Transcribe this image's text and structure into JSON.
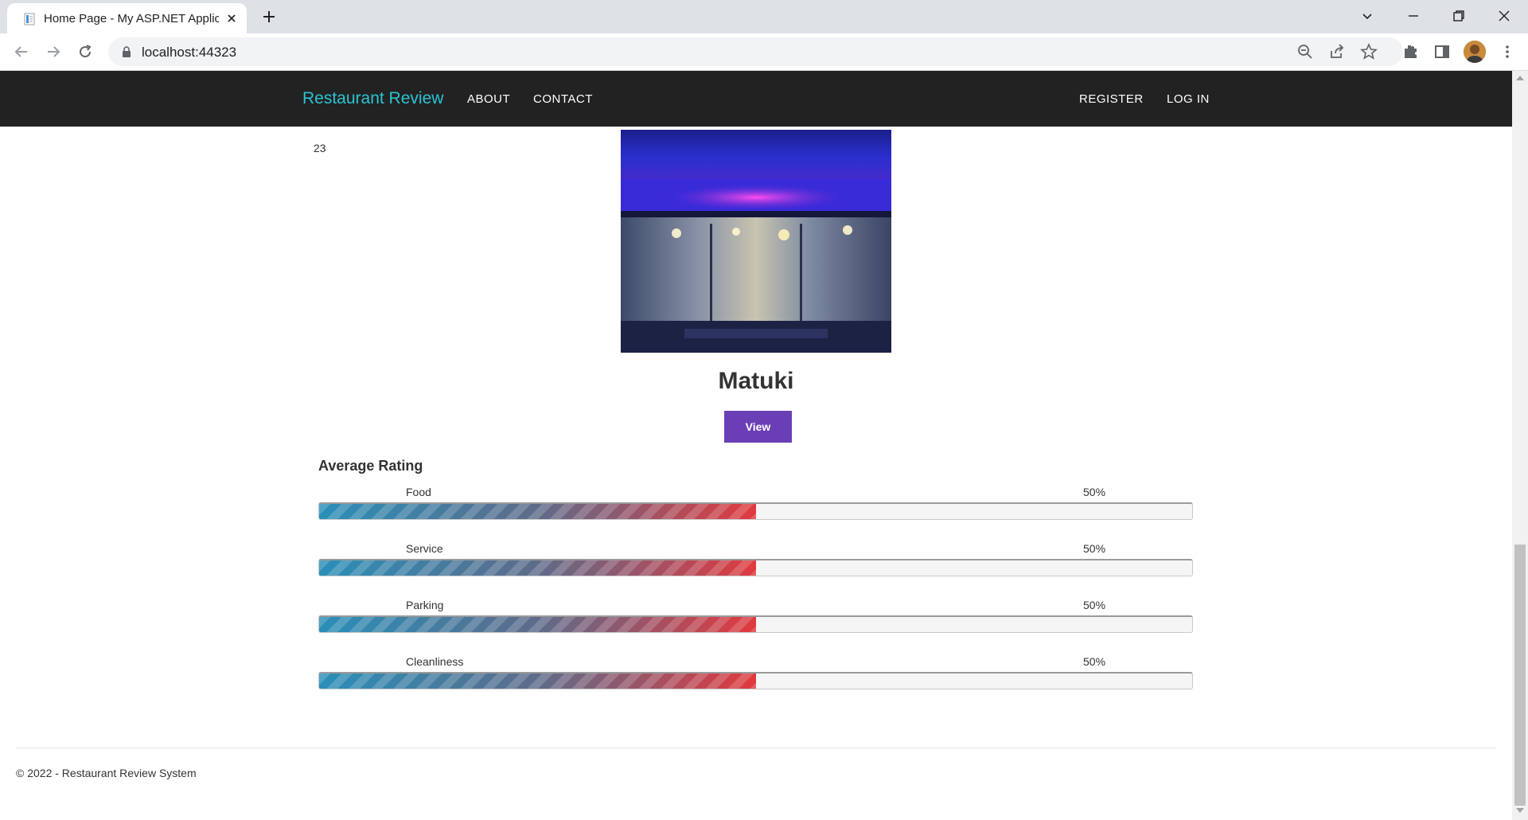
{
  "browser": {
    "tab_title": "Home Page - My ASP.NET Application",
    "url": "localhost:44323"
  },
  "navbar": {
    "brand": "Restaurant Review",
    "links": [
      "ABOUT",
      "CONTACT"
    ],
    "right_links": [
      "REGISTER",
      "LOG IN"
    ]
  },
  "content": {
    "count": "23",
    "restaurant_name": "Matuki",
    "view_label": "View",
    "avg_rating_title": "Average Rating",
    "ratings": [
      {
        "label": "Food",
        "percent_text": "50%",
        "value": 0.5
      },
      {
        "label": "Service",
        "percent_text": "50%",
        "value": 0.5
      },
      {
        "label": "Parking",
        "percent_text": "50%",
        "value": 0.5
      },
      {
        "label": "Cleanliness",
        "percent_text": "50%",
        "value": 0.5
      }
    ]
  },
  "footer": {
    "text": "© 2022 - Restaurant Review System"
  },
  "colors": {
    "navbar_bg": "#222222",
    "brand": "#2bc3d3",
    "view_button": "#6a3fb5",
    "bar_start": "#2a8fb8",
    "bar_end": "#e03a3e"
  }
}
